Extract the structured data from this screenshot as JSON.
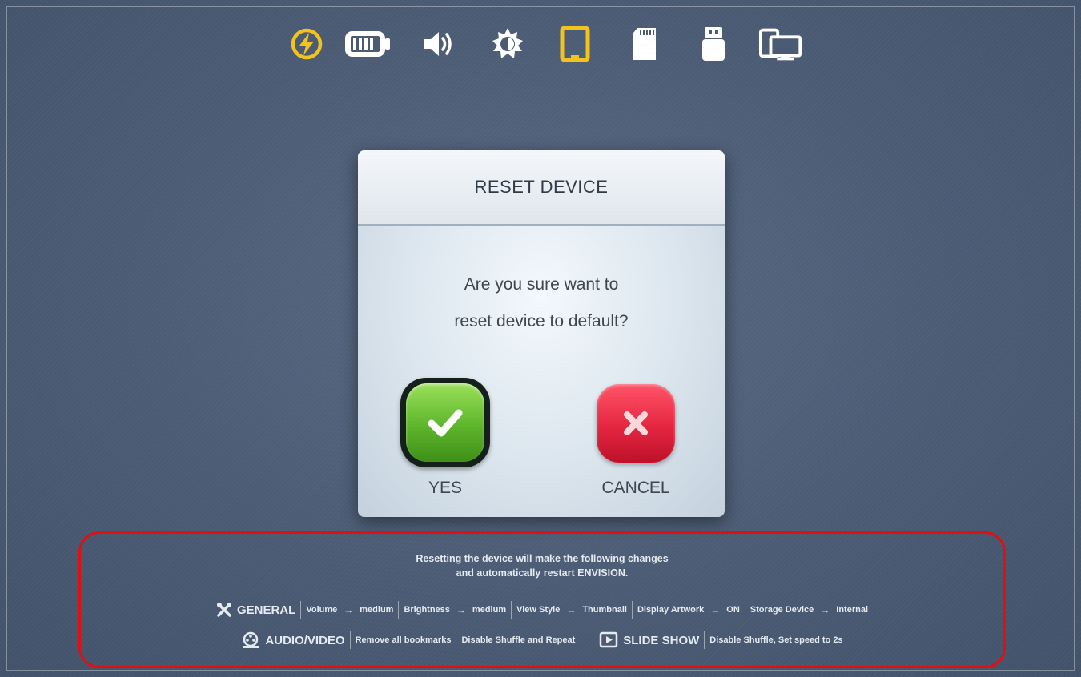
{
  "status_bar": {
    "icons": [
      {
        "name": "power-icon",
        "color": "#f2c21e"
      },
      {
        "name": "battery-icon",
        "color": "#ffffff"
      },
      {
        "name": "volume-icon",
        "color": "#ffffff"
      },
      {
        "name": "brightness-icon",
        "color": "#ffffff"
      },
      {
        "name": "tablet-icon",
        "color": "#f2c21e"
      },
      {
        "name": "sd-card-icon",
        "color": "#ffffff"
      },
      {
        "name": "usb-drive-icon",
        "color": "#ffffff"
      },
      {
        "name": "display-devices-icon",
        "color": "#ffffff"
      }
    ]
  },
  "dialog": {
    "title": "RESET DEVICE",
    "message_line1": "Are you sure want to",
    "message_line2": "reset device to default?",
    "yes_label": "YES",
    "cancel_label": "CANCEL"
  },
  "info": {
    "heading_line1": "Resetting the device will make the following changes",
    "heading_line2": "and automatically restart ENVISION.",
    "general": {
      "label": "GENERAL",
      "items": [
        {
          "key": "Volume",
          "value": "medium"
        },
        {
          "key": "Brightness",
          "value": "medium"
        },
        {
          "key": "View Style",
          "value": "Thumbnail"
        },
        {
          "key": "Display Artwork",
          "value": "ON"
        },
        {
          "key": "Storage Device",
          "value": "Internal"
        }
      ]
    },
    "audio_video": {
      "label": "AUDIO/VIDEO",
      "items": [
        "Remove all bookmarks",
        "Disable Shuffle and Repeat"
      ]
    },
    "slide_show": {
      "label": "SLIDE SHOW",
      "items": [
        "Disable Shuffle, Set speed to 2s"
      ]
    },
    "arrow": "→"
  },
  "colors": {
    "accent_yellow": "#f2c21e",
    "highlight_border": "#e01010",
    "yes_green": "#5db52b",
    "cancel_red": "#e42640"
  }
}
